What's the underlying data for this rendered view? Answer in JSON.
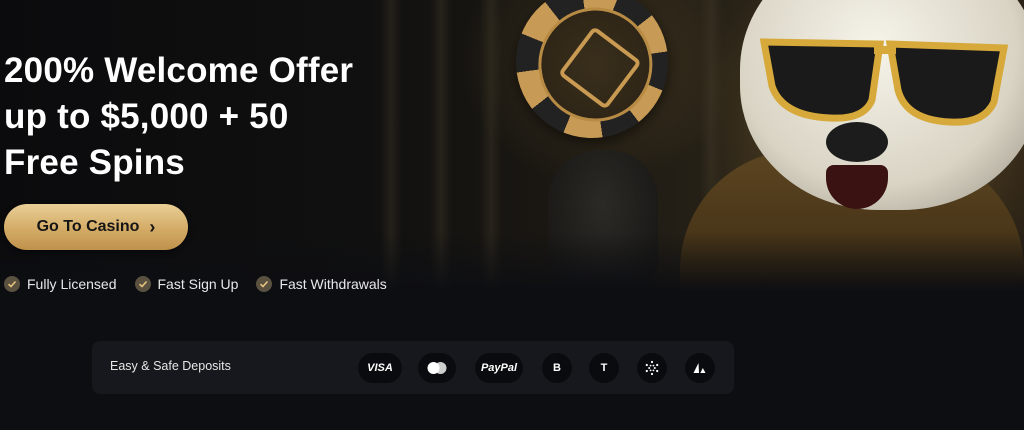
{
  "hero": {
    "headline_lines": [
      "200% Welcome Offer",
      "up to $5,000 + 50",
      "Free Spins"
    ],
    "cta_label": "Go To Casino",
    "cta_icon": "chevron-right-icon",
    "features": [
      {
        "label": "Fully Licensed",
        "icon": "check-icon"
      },
      {
        "label": "Fast Sign Up",
        "icon": "check-icon"
      },
      {
        "label": "Fast Withdrawals",
        "icon": "check-icon"
      }
    ]
  },
  "deposits": {
    "label": "Easy & Safe Deposits",
    "methods": [
      {
        "name": "visa",
        "text": "VISA"
      },
      {
        "name": "mastercard",
        "text": ""
      },
      {
        "name": "paypal",
        "text": "PayPal"
      },
      {
        "name": "bitcoin",
        "text": "B"
      },
      {
        "name": "tether",
        "text": "T"
      },
      {
        "name": "cardano",
        "text": ""
      },
      {
        "name": "avalanche",
        "text": ""
      }
    ]
  },
  "colors": {
    "accent_gold": "#d3ab66",
    "background": "#0d0e12",
    "panel": "#17181d"
  }
}
